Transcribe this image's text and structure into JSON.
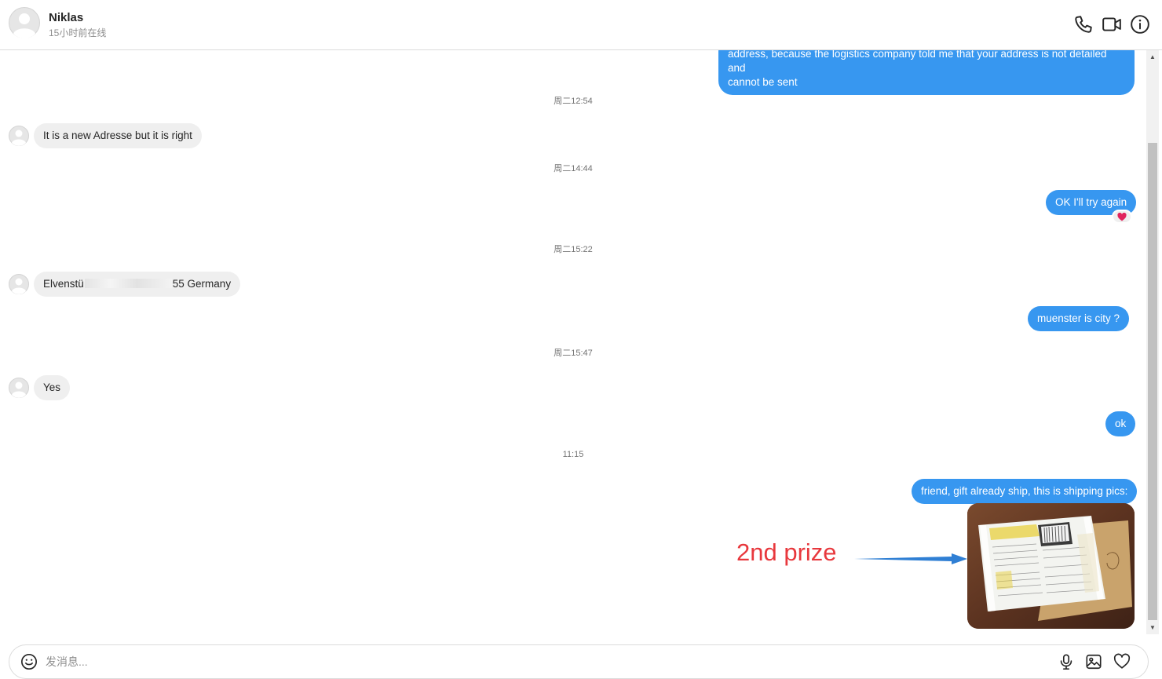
{
  "header": {
    "name": "Niklas",
    "status": "15小时前在线",
    "icons": [
      "phone-icon",
      "video-call-icon",
      "info-icon"
    ]
  },
  "messages": [
    {
      "type": "out",
      "text": "address, because the logistics company told me that your address is not detailed and"
    },
    {
      "type": "out",
      "text": "cannot be sent"
    },
    {
      "type": "timestamp",
      "text": "周二12:54"
    },
    {
      "type": "in",
      "text": "It is a new Adresse but it is right"
    },
    {
      "type": "timestamp",
      "text": "周二14:44"
    },
    {
      "type": "out",
      "text": "OK I'll try again",
      "reaction": "heart"
    },
    {
      "type": "timestamp",
      "text": "周二15:22"
    },
    {
      "type": "in",
      "text_start": "Elvenstü",
      "text_end": "55 Germany",
      "redacted": true
    },
    {
      "type": "out",
      "text": "muenster  is city ?"
    },
    {
      "type": "timestamp",
      "text": "周二15:47"
    },
    {
      "type": "in",
      "text": "Yes"
    },
    {
      "type": "out",
      "text": "ok"
    },
    {
      "type": "timestamp",
      "text": "11:15"
    },
    {
      "type": "out",
      "text": "friend, gift already ship, this is shipping pics:"
    },
    {
      "type": "out-image",
      "alt": "shipping label photo"
    }
  ],
  "annotation": {
    "text": "2nd prize",
    "color": "#e8383d"
  },
  "composer": {
    "placeholder": "发消息...",
    "icons": [
      "emoji-icon",
      "microphone-icon",
      "image-icon",
      "heart-icon"
    ]
  },
  "colors": {
    "accent": "#3797f0",
    "incoming": "#efefef",
    "reaction": "#e0245e"
  }
}
